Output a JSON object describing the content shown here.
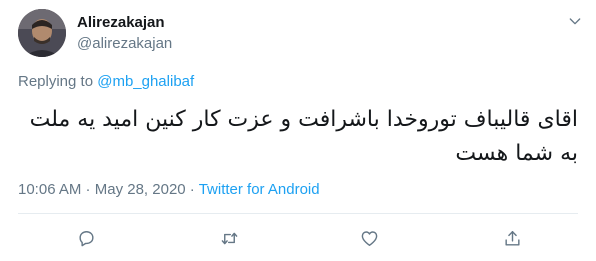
{
  "author": {
    "name": "Alirezakajan",
    "handle": "@alirezakajan"
  },
  "replying": {
    "prefix": "Replying to ",
    "mention": "@mb_ghalibaf"
  },
  "tweet": {
    "text": "اقای قالیباف توروخدا باشرافت و عزت کار کنین امید یه ملت به شما هست"
  },
  "meta": {
    "time": "10:06 AM",
    "separator1": " · ",
    "date": "May 28, 2020",
    "separator2": " · ",
    "source": "Twitter for Android"
  },
  "icons": {
    "caret": "chevron-down-icon",
    "reply": "reply-icon",
    "retweet": "retweet-icon",
    "like": "heart-icon",
    "share": "share-icon"
  },
  "colors": {
    "accent": "#1da1f2",
    "secondary_text": "#657786",
    "icon": "#657786"
  }
}
